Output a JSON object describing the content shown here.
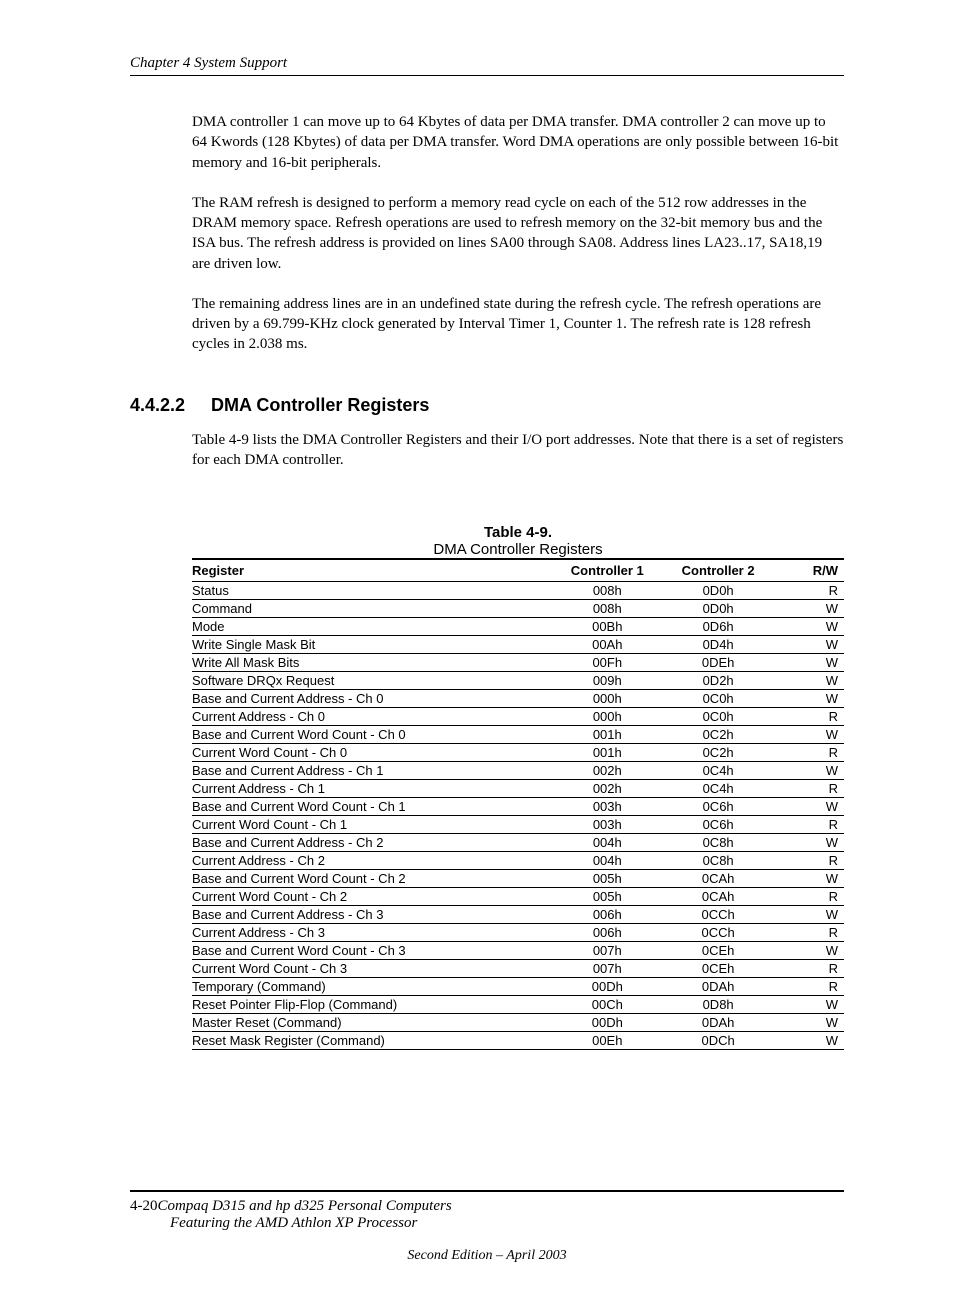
{
  "running_header": "Chapter 4  System Support",
  "paragraphs": [
    "DMA controller 1 can move up to 64 Kbytes of data per DMA transfer. DMA controller 2 can move up to 64 Kwords (128 Kbytes) of data per DMA transfer. Word DMA operations are only possible between 16-bit memory and 16-bit peripherals.",
    "The RAM refresh is designed to perform a memory read cycle on each of the 512 row addresses in the DRAM memory space. Refresh operations are used to refresh memory on the 32-bit memory bus and the ISA bus. The refresh address is provided on lines SA00 through SA08. Address lines LA23..17, SA18,19 are driven low.",
    "The remaining address lines are in an undefined state during the refresh cycle. The refresh operations are driven by a 69.799-KHz clock generated by Interval Timer 1, Counter 1. The refresh rate is 128 refresh cycles in 2.038 ms."
  ],
  "section": {
    "number": "4.4.2.2",
    "title": "DMA Controller Registers",
    "intro": "Table 4-9 lists the DMA Controller Registers and their I/O port addresses. Note that there is a set of registers for each DMA controller."
  },
  "table": {
    "number": "Table 4-9.",
    "title": "DMA Controller Registers",
    "headers": {
      "c0": "Register",
      "c1": "Controller 1",
      "c2": "Controller 2",
      "c3": "R/W"
    },
    "rows": [
      {
        "reg": "Status",
        "c1": "008h",
        "c2": "0D0h",
        "rw": "R"
      },
      {
        "reg": "Command",
        "c1": "008h",
        "c2": "0D0h",
        "rw": "W"
      },
      {
        "reg": "Mode",
        "c1": "00Bh",
        "c2": "0D6h",
        "rw": "W"
      },
      {
        "reg": "Write Single Mask Bit",
        "c1": "00Ah",
        "c2": "0D4h",
        "rw": "W"
      },
      {
        "reg": "Write All Mask Bits",
        "c1": "00Fh",
        "c2": "0DEh",
        "rw": "W"
      },
      {
        "reg": "Software DRQx Request",
        "c1": "009h",
        "c2": "0D2h",
        "rw": "W"
      },
      {
        "reg": "Base and Current Address - Ch 0",
        "c1": "000h",
        "c2": "0C0h",
        "rw": "W"
      },
      {
        "reg": "Current Address - Ch 0",
        "c1": "000h",
        "c2": "0C0h",
        "rw": "R"
      },
      {
        "reg": "Base and Current Word Count - Ch 0",
        "c1": "001h",
        "c2": "0C2h",
        "rw": "W"
      },
      {
        "reg": "Current Word Count - Ch 0",
        "c1": "001h",
        "c2": "0C2h",
        "rw": "R"
      },
      {
        "reg": "Base and Current Address - Ch 1",
        "c1": "002h",
        "c2": "0C4h",
        "rw": "W"
      },
      {
        "reg": "Current Address - Ch 1",
        "c1": "002h",
        "c2": "0C4h",
        "rw": "R"
      },
      {
        "reg": "Base and Current Word Count - Ch 1",
        "c1": "003h",
        "c2": "0C6h",
        "rw": "W"
      },
      {
        "reg": "Current Word Count - Ch 1",
        "c1": "003h",
        "c2": "0C6h",
        "rw": "R"
      },
      {
        "reg": "Base and Current Address - Ch 2",
        "c1": "004h",
        "c2": "0C8h",
        "rw": "W"
      },
      {
        "reg": "Current Address - Ch 2",
        "c1": "004h",
        "c2": "0C8h",
        "rw": "R"
      },
      {
        "reg": "Base and Current Word Count - Ch 2",
        "c1": "005h",
        "c2": "0CAh",
        "rw": "W"
      },
      {
        "reg": "Current Word Count - Ch 2",
        "c1": "005h",
        "c2": "0CAh",
        "rw": "R"
      },
      {
        "reg": "Base and Current Address - Ch 3",
        "c1": "006h",
        "c2": "0CCh",
        "rw": "W"
      },
      {
        "reg": "Current Address - Ch 3",
        "c1": "006h",
        "c2": "0CCh",
        "rw": "R"
      },
      {
        "reg": "Base and Current Word Count - Ch 3",
        "c1": "007h",
        "c2": "0CEh",
        "rw": "W"
      },
      {
        "reg": "Current Word Count - Ch 3",
        "c1": "007h",
        "c2": "0CEh",
        "rw": "R"
      },
      {
        "reg": "Temporary (Command)",
        "c1": "00Dh",
        "c2": "0DAh",
        "rw": "R"
      },
      {
        "reg": "Reset Pointer Flip-Flop (Command)",
        "c1": "00Ch",
        "c2": "0D8h",
        "rw": "W"
      },
      {
        "reg": "Master Reset (Command)",
        "c1": "00Dh",
        "c2": "0DAh",
        "rw": "W"
      },
      {
        "reg": "Reset Mask Register (Command)",
        "c1": "00Eh",
        "c2": "0DCh",
        "rw": "W"
      }
    ]
  },
  "footer": {
    "page_num": "4-20",
    "title_line1": "Compaq D315 and hp d325 Personal Computers",
    "title_line2": "Featuring the AMD Athlon XP Processor",
    "edition": "Second Edition – April 2003"
  }
}
